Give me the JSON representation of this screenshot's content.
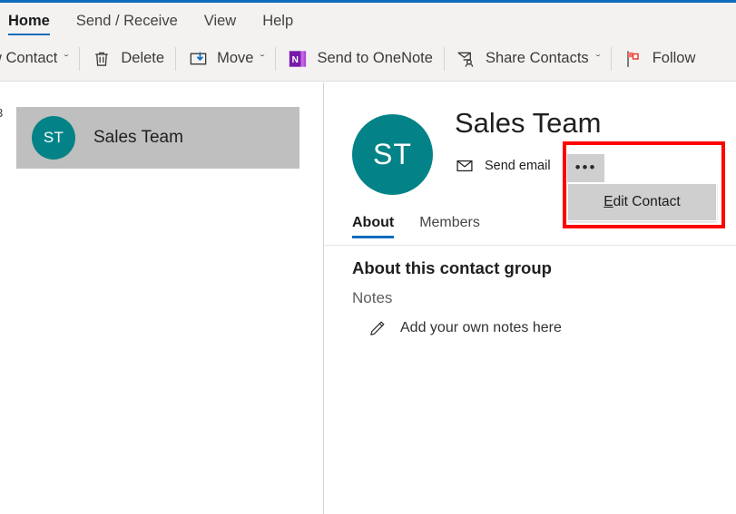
{
  "theme": {
    "accent_blue": "#0f6cbd",
    "avatar_teal": "#038387",
    "highlight_red": "#ff0000",
    "ribbon_bg": "#f3f2f1",
    "selection_gray": "#bfbfbf",
    "menu_gray": "#cfcfcf"
  },
  "ribbon": {
    "tabs": [
      {
        "label": "Home",
        "active": true
      },
      {
        "label": "Send / Receive",
        "active": false
      },
      {
        "label": "View",
        "active": false
      },
      {
        "label": "Help",
        "active": false
      }
    ],
    "commands": [
      {
        "label": "w Contact",
        "icon": "new-contact-icon",
        "caret": "ˇ"
      },
      {
        "label": "Delete",
        "icon": "trash-icon",
        "caret": ""
      },
      {
        "label": "Move",
        "icon": "move-folder-icon",
        "caret": "ˇ"
      },
      {
        "label": "Send to OneNote",
        "icon": "onenote-icon",
        "caret": ""
      },
      {
        "label": "Share Contacts",
        "icon": "share-contacts-icon",
        "caret": "ˇ"
      },
      {
        "label": "Follow",
        "icon": "follow-up-flag-icon",
        "caret": ""
      }
    ]
  },
  "list_pane": {
    "count_label": "3",
    "alpha_index": [
      "",
      "",
      "",
      "",
      "",
      ""
    ],
    "selected_contact": {
      "initials": "ST",
      "name": "Sales Team"
    }
  },
  "detail": {
    "avatar_initials": "ST",
    "title": "Sales Team",
    "send_email_label": "Send email",
    "send_email_icon": "envelope-icon",
    "overflow_button": {
      "icon": "ellipsis-icon",
      "dots": "•••"
    },
    "dropdown": {
      "items": [
        {
          "accel": "E",
          "rest": "dit Contact"
        }
      ]
    },
    "tabs": [
      {
        "label": "About",
        "active": true
      },
      {
        "label": "Members",
        "active": false
      }
    ],
    "about_heading": "About this contact group",
    "notes_label": "Notes",
    "notes_placeholder": "Add your own notes here",
    "notes_icon": "pencil-icon"
  }
}
